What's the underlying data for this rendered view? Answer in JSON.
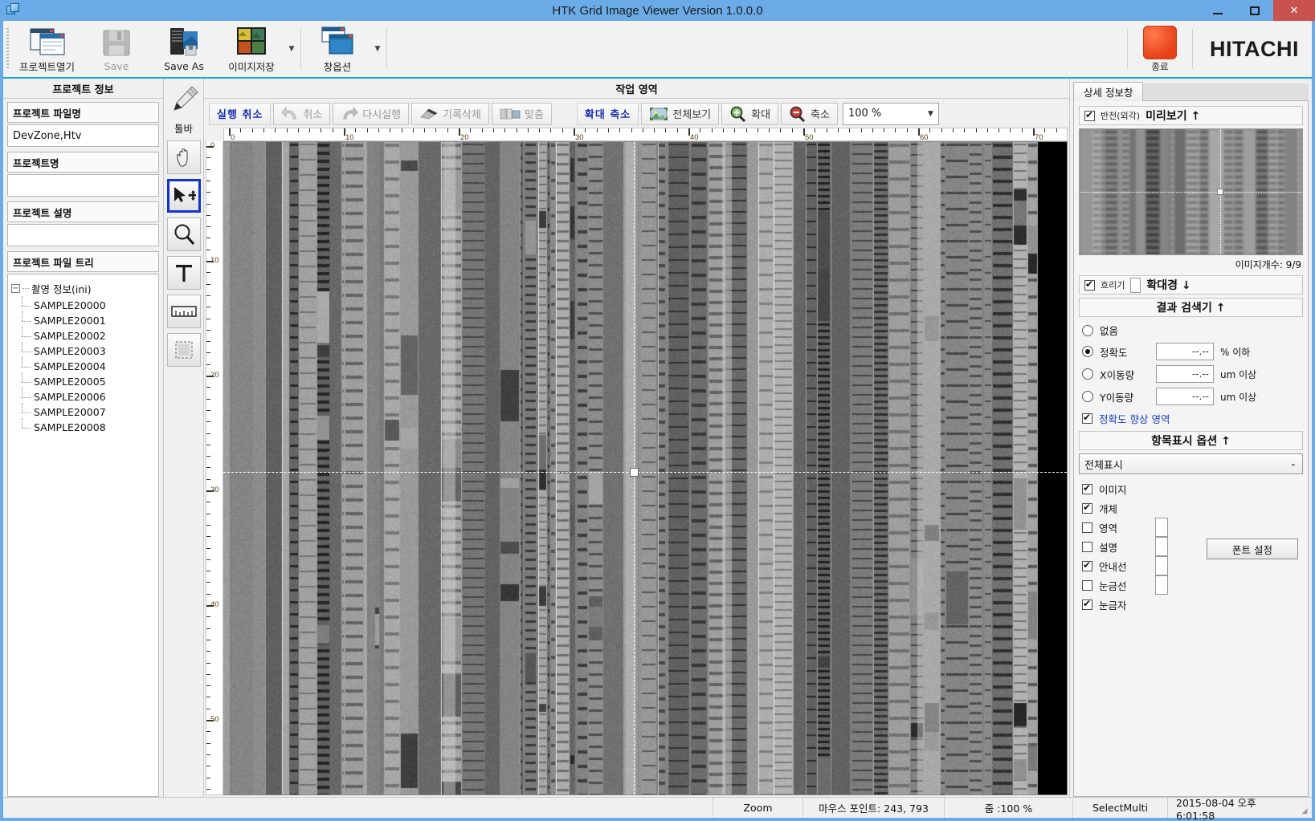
{
  "window": {
    "title": "HTK Grid Image Viewer Version 1.0.0.0",
    "icon": "app-window-icon",
    "minimize": "−",
    "maximize": "□",
    "close": "✕"
  },
  "ribbon": {
    "items": [
      {
        "label": "프로젝트열기",
        "icon": "open-project-icon",
        "disabled": false,
        "dropdown": false
      },
      {
        "label": "Save",
        "icon": "floppy-disk-icon",
        "disabled": true,
        "dropdown": false
      },
      {
        "label": "Save As",
        "icon": "server-save-icon",
        "disabled": false,
        "dropdown": false
      },
      {
        "label": "이미지저장",
        "icon": "image-save-icon",
        "disabled": false,
        "dropdown": true
      },
      {
        "label": "창옵션",
        "icon": "window-options-icon",
        "disabled": false,
        "dropdown": true
      }
    ],
    "exit": {
      "label": "종료",
      "icon": "exit-red-icon",
      "color": "#e8421a"
    },
    "brand": "HITACHI"
  },
  "left_panel": {
    "header": "프로젝트 정보",
    "fields": [
      {
        "label": "프로젝트 파일명",
        "value": "DevZone,Htv"
      },
      {
        "label": "프로젝트명",
        "value": ""
      },
      {
        "label": "프로젝트 설명",
        "value": ""
      }
    ],
    "tree_label": "프로젝트 파일 트리",
    "tree": {
      "root": "촬영 정보(ini)",
      "toggle": "−",
      "children": [
        "SAMPLE20000",
        "SAMPLE20001",
        "SAMPLE20002",
        "SAMPLE20003",
        "SAMPLE20004",
        "SAMPLE20005",
        "SAMPLE20006",
        "SAMPLE20007",
        "SAMPLE20008"
      ]
    }
  },
  "tools": {
    "label": "툴바",
    "pen_icon": "marker-pen-icon",
    "buttons": [
      {
        "name": "hand-tool",
        "icon": "hand-icon",
        "selected": false
      },
      {
        "name": "select-move-tool",
        "icon": "arrow-move-icon",
        "selected": true
      },
      {
        "name": "zoom-tool",
        "icon": "magnifier-icon",
        "selected": false
      },
      {
        "name": "text-tool",
        "icon": "text-t-icon",
        "selected": false
      },
      {
        "name": "measure-tool",
        "icon": "ruler-icon",
        "selected": false
      },
      {
        "name": "region-tool",
        "icon": "crop-rect-icon",
        "selected": false
      }
    ]
  },
  "work_area": {
    "header": "작업 영역",
    "undo_group": {
      "title": "실행 취소",
      "buttons": [
        {
          "label": "취소",
          "icon": "undo-arrow-icon",
          "disabled": true
        },
        {
          "label": "다시실행",
          "icon": "redo-arrow-icon",
          "disabled": true
        },
        {
          "label": "기록삭제",
          "icon": "eraser-icon",
          "disabled": true
        },
        {
          "label": "맞춤",
          "icon": "fit-icon",
          "disabled": true
        }
      ]
    },
    "zoom_group": {
      "title": "확대 축소",
      "buttons": [
        {
          "label": "전체보기",
          "icon": "fit-image-icon",
          "disabled": false
        },
        {
          "label": "확대",
          "icon": "zoom-in-icon",
          "disabled": false
        },
        {
          "label": "축소",
          "icon": "zoom-out-icon",
          "disabled": false
        }
      ],
      "zoom_value": "100 %",
      "zoom_options": [
        "100 %"
      ]
    },
    "ruler": {
      "h_labels": [
        "0",
        "10",
        "20",
        "30",
        "40",
        "50",
        "60",
        "70"
      ],
      "v_labels": [
        "0",
        "10",
        "20",
        "30",
        "40",
        "50"
      ],
      "unit_step": 10
    }
  },
  "right_panel": {
    "tab": "상세 정보창",
    "preview": {
      "invert_label": "반전(외각)",
      "invert_checked": true,
      "title": "미리보기 ↑",
      "image_count": "이미지개수: 9/9"
    },
    "magnifier": {
      "blur_label": "흐리기",
      "blur_checked": true,
      "second_checked": false,
      "title": "확대경 ↓"
    },
    "result_search": {
      "title": "결과 검색기 ↑",
      "options": [
        {
          "label": "없음",
          "selected": false,
          "value": null,
          "unit": ""
        },
        {
          "label": "정확도",
          "selected": true,
          "value": "--.--",
          "unit": "% 이하"
        },
        {
          "label": "X이동량",
          "selected": false,
          "value": "--.--",
          "unit": "um 이상"
        },
        {
          "label": "Y이동량",
          "selected": false,
          "value": "--.--",
          "unit": "um 이상"
        }
      ],
      "enhance_label": "정확도 향상 영역",
      "enhance_checked": true
    },
    "display_options": {
      "title": "항목표시 옵션 ↑",
      "select_value": "전체표시",
      "items": [
        {
          "label": "이미지",
          "checked": true,
          "swatch": false
        },
        {
          "label": "개체",
          "checked": true,
          "swatch": false
        },
        {
          "label": "영역",
          "checked": false,
          "swatch": true
        },
        {
          "label": "설명",
          "checked": false,
          "swatch": true
        },
        {
          "label": "안내선",
          "checked": true,
          "swatch": true
        },
        {
          "label": "눈금선",
          "checked": false,
          "swatch": true
        },
        {
          "label": "눈금자",
          "checked": true,
          "swatch": false
        }
      ],
      "font_button": "폰트 설정"
    }
  },
  "status_bar": {
    "zoom_label": "Zoom",
    "mouse_point": "마우스 포인트: 243, 793",
    "zoom_percent": "줌 :100 %",
    "mode": "SelectMulti",
    "timestamp": "2015-08-04 오후 6:01:58"
  }
}
